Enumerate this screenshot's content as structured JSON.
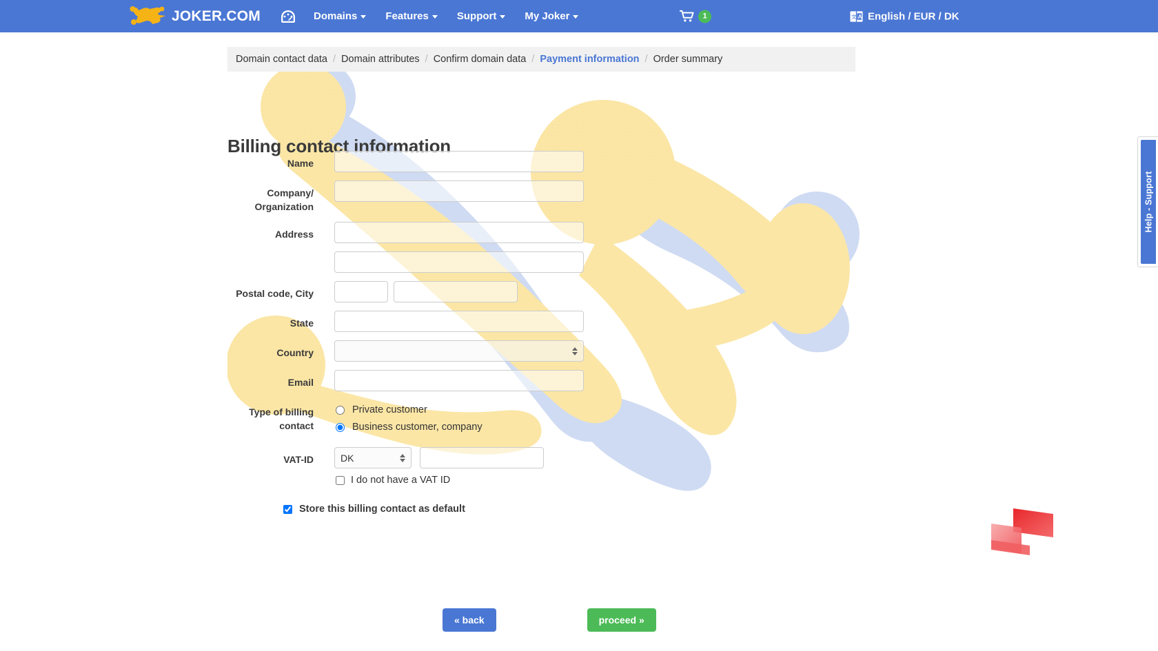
{
  "header": {
    "brand": "JOKER.COM",
    "dashboard_icon": "dashboard-icon",
    "nav": [
      {
        "label": "Domains",
        "has_caret": true
      },
      {
        "label": "Features",
        "has_caret": true
      },
      {
        "label": "Support",
        "has_caret": true
      },
      {
        "label": "My Joker",
        "has_caret": true
      }
    ],
    "cart": {
      "icon": "shopping-cart-icon",
      "count": "1"
    },
    "locale": {
      "icon": "language-book-icon",
      "label": "English / EUR / DK"
    },
    "bg_color": "#4a77d4"
  },
  "breadcrumb": {
    "separator": "/",
    "items": [
      {
        "label": "Domain contact data",
        "active": false
      },
      {
        "label": "Domain attributes",
        "active": false
      },
      {
        "label": "Confirm domain data",
        "active": false
      },
      {
        "label": "Payment information",
        "active": true
      },
      {
        "label": "Order summary",
        "active": false
      }
    ],
    "active_color": "#4a77d4"
  },
  "form": {
    "title": "Billing contact information",
    "labels": {
      "name": "Name",
      "company": "Company/ Organization",
      "company_line1": "Company/",
      "company_line2": "Organization",
      "address": "Address",
      "address2": "",
      "postal_city": "Postal code, City",
      "state": "State",
      "country": "Country",
      "email": "Email",
      "billing_type_line1": "Type of billing",
      "billing_type_line2": "contact",
      "vat_id": "VAT-ID"
    },
    "values": {
      "name": "",
      "company": "",
      "address": "",
      "address2": "",
      "postal_code": "",
      "city": "",
      "state": "",
      "country": "",
      "email": "",
      "vat_country": "DK",
      "vat_number": ""
    },
    "placeholders": {
      "name": "",
      "company": "",
      "address": "",
      "address2": "",
      "postal_code": "",
      "city": "",
      "state": "",
      "email": "",
      "vat_number": ""
    },
    "billing_type_options": [
      {
        "label": "Private customer",
        "selected": false
      },
      {
        "label": "Business customer, company",
        "selected": true
      }
    ],
    "no_vat_checkbox": {
      "label": "I do not have a VAT ID",
      "checked": false
    },
    "store_default_checkbox": {
      "label": "Store this billing contact as default",
      "checked": true
    }
  },
  "buttons": {
    "back": "« back",
    "proceed": "proceed »",
    "back_color": "#4a77d4",
    "proceed_color": "#4cbb57"
  },
  "help_tab": {
    "label": "Help - Support",
    "color": "#4a77d4"
  },
  "decor": {
    "watermark": "joker-mascot-watermark",
    "corner_logo": "red-ribbon-logo",
    "watermark_yellow": "#fbe7a8",
    "watermark_blue": "#c3d2ef",
    "corner_logo_red": "#e8282b"
  }
}
